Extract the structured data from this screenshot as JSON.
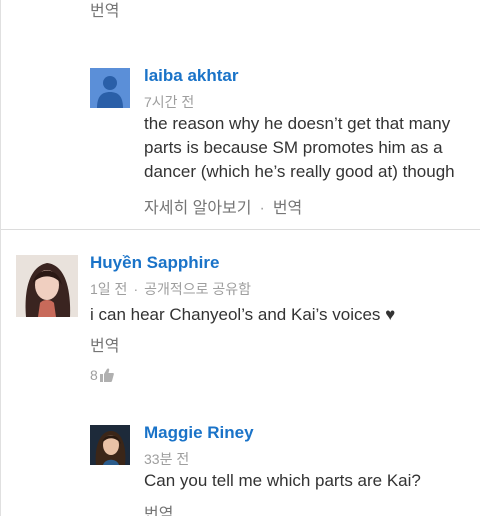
{
  "top_partial": {
    "translate_label": "번역"
  },
  "comments": [
    {
      "author": "laiba akhtar",
      "meta": "7시간 전",
      "text_lines": [
        "the reason why he doesn’t get that many",
        "parts is because SM promotes him as a",
        "dancer (which he’s really good at) though"
      ],
      "see_more_label": "자세히 알아보기",
      "translate_label": "번역"
    },
    {
      "author": "Huyền Sapphire",
      "meta_time": "1일 전",
      "meta_visibility": "공개적으로 공유함",
      "text": "i can hear Chanyeol’s and Kai’s voices ♥",
      "translate_label": "번역",
      "plus_count": "8"
    },
    {
      "author": "Maggie Riney",
      "meta": "33분 전",
      "text": "Can you tell me which parts are Kai?",
      "translate_label": "번역"
    }
  ],
  "colors": {
    "author_link": "#1a73c8",
    "meta_gray": "#9e9e9e",
    "body_text": "#333333",
    "default_avatar_bg": "#5b8fd8"
  }
}
